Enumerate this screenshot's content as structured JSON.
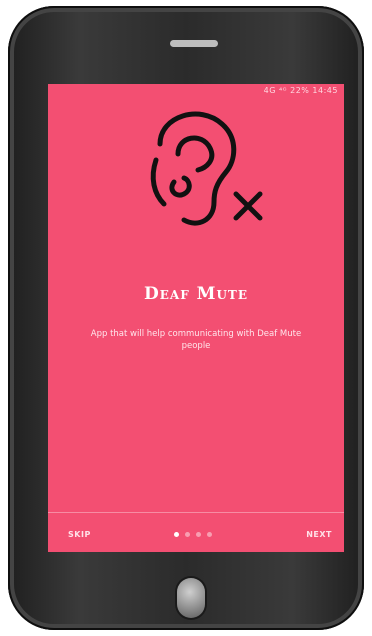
{
  "status_bar": {
    "text": "4G ⁴ᴳ 22% 14:45"
  },
  "onboarding": {
    "icon": "ear-muted-icon",
    "title": "Deaf Mute",
    "description": "App that will help communicating with Deaf Mute people",
    "current_page": 1,
    "total_pages": 4
  },
  "nav": {
    "skip_label": "SKIP",
    "next_label": "NEXT"
  },
  "colors": {
    "screen_bg": "#f34f72",
    "text": "#ffffff",
    "device": "#2b2b2b"
  }
}
